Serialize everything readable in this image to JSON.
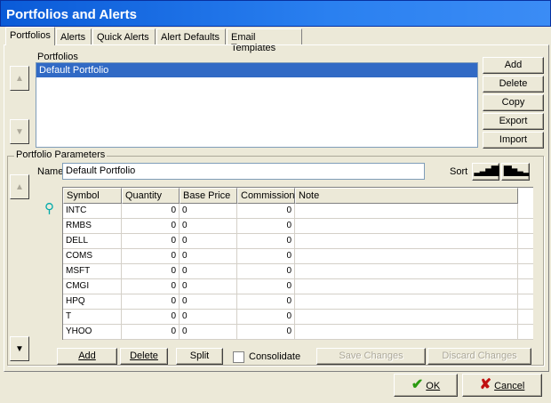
{
  "window": {
    "title": "Portfolios and Alerts"
  },
  "tabs": [
    "Portfolios",
    "Alerts",
    "Quick Alerts",
    "Alert Defaults",
    "Email Templates"
  ],
  "portfolios": {
    "label": "Portfolios",
    "items": [
      "Default Portfolio"
    ],
    "buttons": [
      "Add",
      "Delete",
      "Copy",
      "Export",
      "Import"
    ]
  },
  "params": {
    "group_label": "Portfolio Parameters",
    "name_label": "Name",
    "name_value": "Default Portfolio",
    "sort_label": "Sort",
    "columns": [
      "Symbol",
      "Quantity",
      "Base Price",
      "Commission",
      "Note"
    ],
    "rows": [
      [
        "INTC",
        "0",
        "0",
        "0",
        ""
      ],
      [
        "RMBS",
        "0",
        "0",
        "0",
        ""
      ],
      [
        "DELL",
        "0",
        "0",
        "0",
        ""
      ],
      [
        "COMS",
        "0",
        "0",
        "0",
        ""
      ],
      [
        "MSFT",
        "0",
        "0",
        "0",
        ""
      ],
      [
        "CMGI",
        "0",
        "0",
        "0",
        ""
      ],
      [
        "HPQ",
        "0",
        "0",
        "0",
        ""
      ],
      [
        "T",
        "0",
        "0",
        "0",
        ""
      ],
      [
        "YHOO",
        "0",
        "0",
        "0",
        ""
      ]
    ],
    "add": "Add",
    "delete": "Delete",
    "split": "Split",
    "consolidate": "Consolidate",
    "save": "Save Changes",
    "discard": "Discard Changes"
  },
  "footer": {
    "ok": "OK",
    "cancel": "Cancel"
  }
}
